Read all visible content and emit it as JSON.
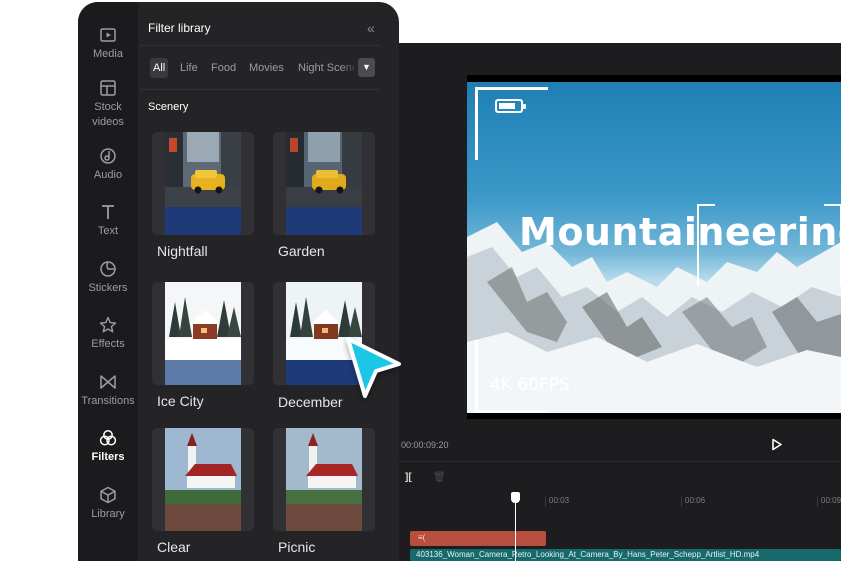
{
  "preview": {
    "title": "Mountaineering",
    "fps_label": "4K 60FPS"
  },
  "timeline": {
    "timecode": "/ 00:00:09:20",
    "ticks": [
      "00:03",
      "00:06",
      "00:09"
    ],
    "audio_clip_label": "≡(",
    "video_clip_label": "403136_Woman_Camera_Retro_Looking_At_Camera_By_Hans_Peter_Schepp_Artlist_HD.mp4"
  },
  "rail": {
    "items": [
      {
        "label": "Media",
        "icon": "media-icon"
      },
      {
        "label": "Stock",
        "label2": "videos",
        "icon": "stock-videos-icon"
      },
      {
        "label": "Audio",
        "icon": "audio-icon"
      },
      {
        "label": "Text",
        "icon": "text-icon"
      },
      {
        "label": "Stickers",
        "icon": "stickers-icon"
      },
      {
        "label": "Effects",
        "icon": "effects-icon"
      },
      {
        "label": "Transitions",
        "icon": "transitions-icon"
      },
      {
        "label": "Filters",
        "icon": "filters-icon",
        "active": true
      },
      {
        "label": "Library",
        "icon": "library-icon"
      }
    ]
  },
  "filter_panel": {
    "title": "Filter library",
    "collapse_glyph": "«",
    "tabs": [
      "All",
      "Life",
      "Food",
      "Movies",
      "Night Scenes"
    ],
    "section": "Scenery",
    "filters": [
      {
        "name": "Nightfall"
      },
      {
        "name": "Garden"
      },
      {
        "name": "Ice City"
      },
      {
        "name": "December"
      },
      {
        "name": "Clear"
      },
      {
        "name": "Picnic"
      }
    ]
  },
  "colors": {
    "panel_bg": "#242427",
    "rail_bg": "#1b1b1d",
    "accent_cursor": "#1fc6e6",
    "audio_clip": "#b84f3e",
    "video_clip": "#176a6c"
  }
}
